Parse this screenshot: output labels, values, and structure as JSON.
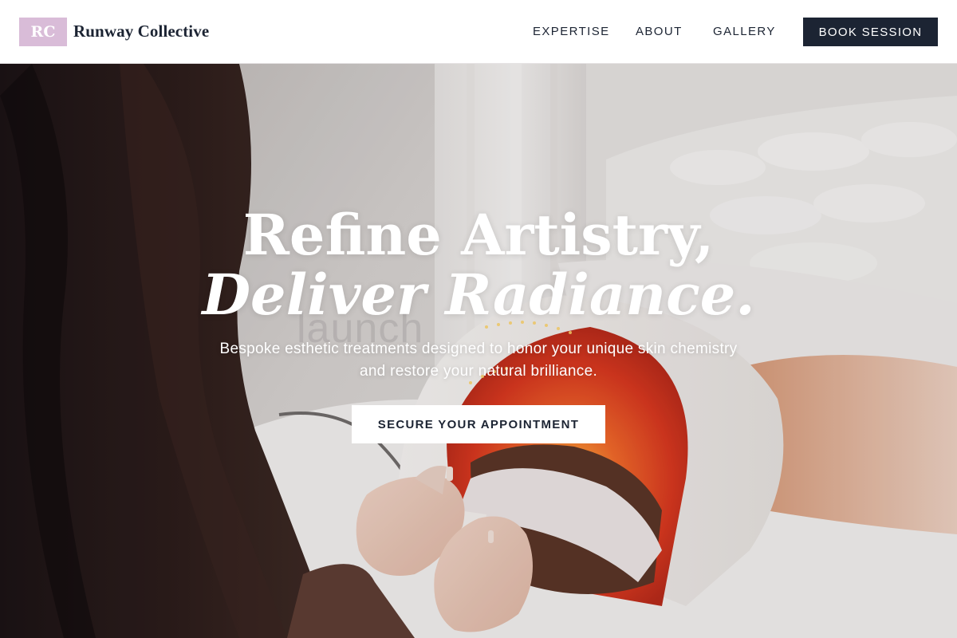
{
  "brand": {
    "logo_initials": "RC",
    "name": "Runway Collective",
    "logo_color": "#d9bcd8"
  },
  "nav": {
    "items": [
      {
        "label": "EXPERTISE"
      },
      {
        "label": "ABOUT"
      },
      {
        "label": "GALLERY"
      }
    ],
    "book_label": "BOOK SESSION"
  },
  "hero": {
    "headline_line1": "Refine Artistry,",
    "headline_line2": "Deliver Radiance.",
    "subtitle": "Bespoke esthetic treatments designed to honor your unique skin chemistry and restore your natural brilliance.",
    "cta_label": "SECURE YOUR APPOINTMENT",
    "watermark": "launch",
    "image_description": "esthetician-applying-led-light-therapy-mask"
  },
  "colors": {
    "navy": "#1c2433",
    "white": "#ffffff",
    "led_red": "#e4502a"
  }
}
